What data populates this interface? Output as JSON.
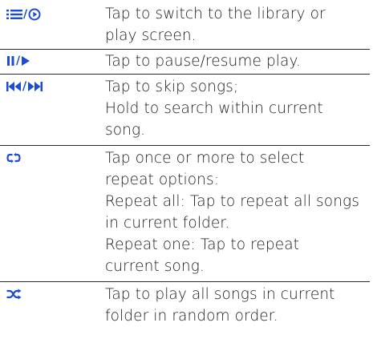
{
  "accent_color": "#1c4bd6",
  "rows": [
    {
      "icon_names": [
        "library-icon",
        "play-screen-icon"
      ],
      "icon_separator": "/",
      "lines": [
        "Tap to switch to the library or",
        "play screen."
      ]
    },
    {
      "icon_names": [
        "pause-icon",
        "play-icon"
      ],
      "icon_separator": "/",
      "lines": [
        "Tap to pause/resume play."
      ]
    },
    {
      "icon_names": [
        "skip-back-icon",
        "skip-forward-icon"
      ],
      "icon_separator": "/",
      "lines": [
        "Tap to skip songs;",
        "Hold to search within current",
        "song."
      ]
    },
    {
      "icon_names": [
        "repeat-icon"
      ],
      "lines": [
        "Tap once or more to select",
        "repeat options:",
        "Repeat all: Tap to repeat all songs",
        "in current folder.",
        "Repeat one: Tap to repeat",
        "current song."
      ]
    },
    {
      "icon_names": [
        "shuffle-icon"
      ],
      "lines": [
        "Tap to play all songs in current",
        "folder in random order."
      ]
    }
  ]
}
